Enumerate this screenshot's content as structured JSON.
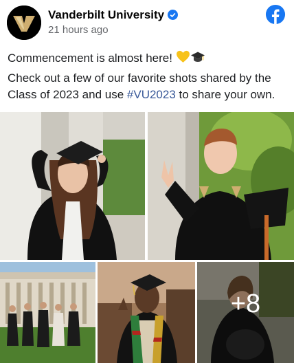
{
  "post": {
    "author": "Vanderbilt University",
    "timestamp": "21 hours ago",
    "line1": "Commencement is almost here!",
    "line2_prefix": "Check out a few of our favorite shots shared by the Class of 2023 and use ",
    "hashtag": "#VU2023",
    "line2_suffix": " to share your own.",
    "more_photos": "+8"
  },
  "icons": [
    "vanderbilt-logo-icon",
    "verified-badge-icon",
    "facebook-logo-icon",
    "yellow-heart-icon",
    "graduation-cap-icon"
  ],
  "colors": {
    "brand_blue": "#1877f2",
    "hashtag": "#385898",
    "vanderbilt_gold": "#cfae70",
    "muted_text": "#65676b"
  }
}
